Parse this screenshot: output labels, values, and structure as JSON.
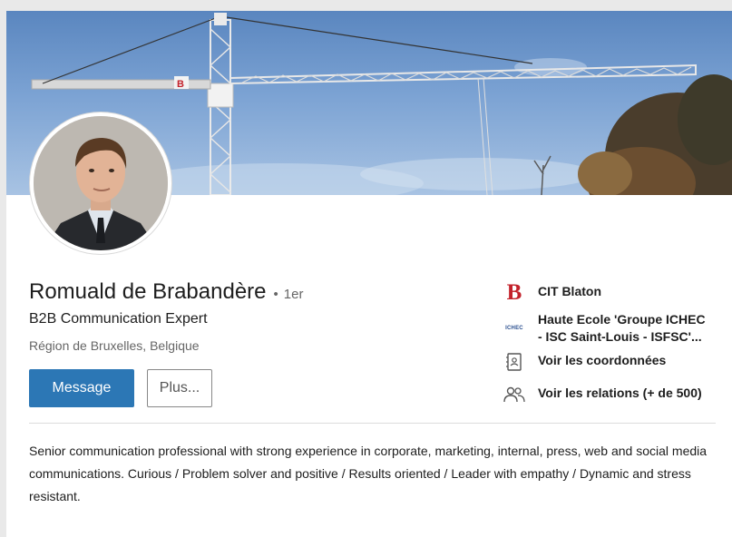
{
  "profile": {
    "name": "Romuald de Brabandère",
    "degree_sep": "•",
    "degree": "1er",
    "headline": "B2B Communication Expert",
    "location": "Région de Bruxelles, Belgique"
  },
  "actions": {
    "message_label": "Message",
    "more_label": "Plus..."
  },
  "sidebar": {
    "company": {
      "label": "CIT Blaton",
      "icon": "cit-blaton-logo",
      "logo_letter": "B",
      "logo_color": "#c3222b"
    },
    "school": {
      "label_line1": "Haute Ecole 'Groupe ICHEC",
      "label_line2": "- ISC Saint-Louis - ISFSC'...",
      "icon": "ichec-logo",
      "logo_text": "ICHEC"
    },
    "contact": {
      "label": "Voir les coordonnées",
      "icon": "contact-card-icon"
    },
    "connections": {
      "label": "Voir les relations (+ de 500)",
      "icon": "people-icon"
    }
  },
  "about": {
    "text": "Senior communication professional with strong experience in corporate, marketing, internal, press, web and social media communications. Curious / Problem solver and positive / Results oriented / Leader with empathy / Dynamic and stress resistant."
  },
  "colors": {
    "primary_button": "#2c77b5",
    "sky": "#6f99cf"
  }
}
